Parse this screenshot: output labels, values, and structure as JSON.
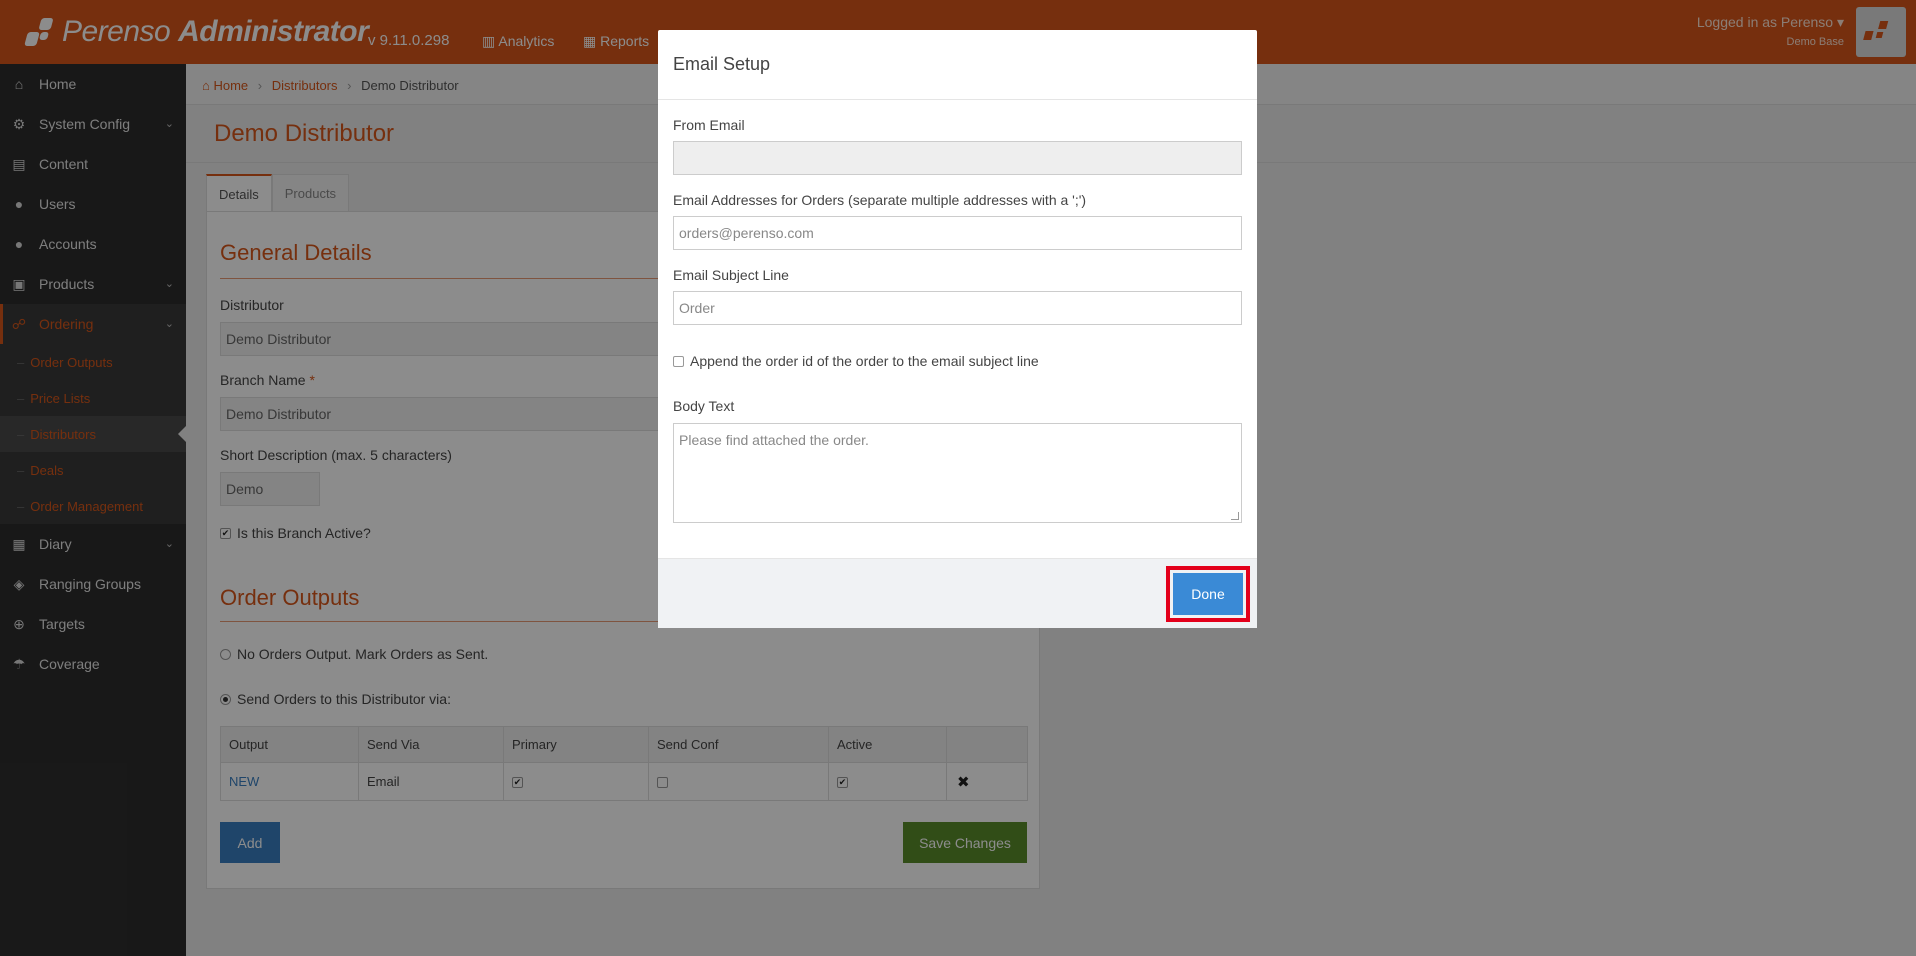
{
  "header": {
    "brand_light": "Perenso",
    "brand_bold": "Administrator",
    "version": "v 9.11.0.298",
    "nav": [
      {
        "icon": "bar-chart-icon",
        "label": "Analytics"
      },
      {
        "icon": "table-icon",
        "label": "Reports"
      }
    ],
    "user_label": "Logged in as Perenso",
    "user_sub": "Demo Base"
  },
  "sidebar": {
    "items": [
      {
        "icon": "home-icon",
        "label": "Home"
      },
      {
        "icon": "gear-icon",
        "label": "System Config",
        "expandable": true
      },
      {
        "icon": "file-icon",
        "label": "Content"
      },
      {
        "icon": "user-icon",
        "label": "Users"
      },
      {
        "icon": "users-icon",
        "label": "Accounts"
      },
      {
        "icon": "gift-icon",
        "label": "Products",
        "expandable": true
      },
      {
        "icon": "cart-icon",
        "label": "Ordering",
        "expandable": true,
        "active": true
      },
      {
        "icon": "calendar-icon",
        "label": "Diary",
        "expandable": true
      },
      {
        "icon": "cubes-icon",
        "label": "Ranging Groups"
      },
      {
        "icon": "crosshairs-icon",
        "label": "Targets"
      },
      {
        "icon": "umbrella-icon",
        "label": "Coverage"
      }
    ],
    "ordering_sub": [
      {
        "label": "Order Outputs"
      },
      {
        "label": "Price Lists"
      },
      {
        "label": "Distributors",
        "current": true
      },
      {
        "label": "Deals"
      },
      {
        "label": "Order Management"
      }
    ]
  },
  "breadcrumb": {
    "home": "Home",
    "parent": "Distributors",
    "current": "Demo Distributor",
    "sep": "›"
  },
  "page": {
    "title": "Demo Distributor",
    "tabs": [
      "Details",
      "Products"
    ],
    "general_title": "General Details",
    "distributor_label": "Distributor",
    "distributor_value": "Demo Distributor",
    "branch_label": "Branch Name",
    "branch_required": "*",
    "branch_value": "Demo Distributor",
    "short_label": "Short Description (max. 5 characters)",
    "short_value": "Demo",
    "active_label": "Is this Branch Active?",
    "outputs_title": "Order Outputs",
    "opt_none": "No Orders Output. Mark Orders as Sent.",
    "opt_send": "Send Orders to this Distributor via:",
    "table": {
      "headers": [
        "Output",
        "Send Via",
        "Primary",
        "Send Conf",
        "Active",
        ""
      ],
      "rows": [
        {
          "output": "NEW",
          "send_via": "Email",
          "primary": true,
          "send_conf": false,
          "active": true
        }
      ]
    },
    "add_label": "Add",
    "save_label": "Save Changes"
  },
  "modal": {
    "title": "Email Setup",
    "from_label": "From Email",
    "from_value": "",
    "orders_label": "Email Addresses for Orders (separate multiple addresses with a ';')",
    "orders_value": "orders@perenso.com",
    "subject_label": "Email Subject Line",
    "subject_value": "Order",
    "append_label": "Append the order id of the order to the email subject line",
    "body_label": "Body Text",
    "body_value": "Please find attached the order.",
    "done_label": "Done"
  }
}
